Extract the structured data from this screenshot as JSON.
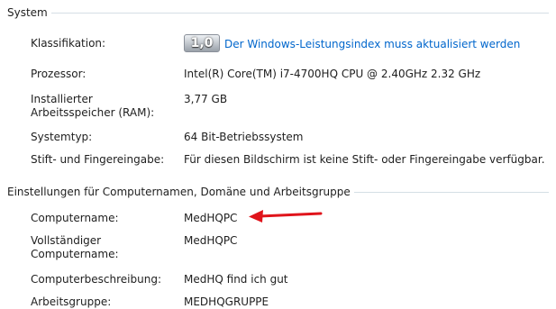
{
  "system": {
    "header": "System",
    "classification_label": "Klassifikation:",
    "score": "1,0",
    "score_link": "Der Windows-Leistungsindex muss aktualisiert werden",
    "processor_label": "Prozessor:",
    "processor_value": "Intel(R) Core(TM) i7-4700HQ CPU @ 2.40GHz   2.32 GHz",
    "ram_label": "Installierter Arbeitsspeicher (RAM):",
    "ram_value": "3,77 GB",
    "systemtype_label": "Systemtyp:",
    "systemtype_value": "64 Bit-Betriebssystem",
    "pen_label": "Stift- und Fingereingabe:",
    "pen_value": "Für diesen Bildschirm ist keine Stift- oder Fingereingabe verfügbar."
  },
  "computer": {
    "header": "Einstellungen für Computernamen, Domäne und Arbeitsgruppe",
    "name_label": "Computername:",
    "name_value": "MedHQPC",
    "fullname_label": "Vollständiger Computername:",
    "fullname_value": "MedHQPC",
    "desc_label": "Computerbeschreibung:",
    "desc_value": "MedHQ find ich gut",
    "workgroup_label": "Arbeitsgruppe:",
    "workgroup_value": "MEDHQGRUPPE"
  },
  "colors": {
    "link": "#0066cc",
    "annotation_arrow": "#e0141b",
    "group_line": "#d5dfe5"
  }
}
